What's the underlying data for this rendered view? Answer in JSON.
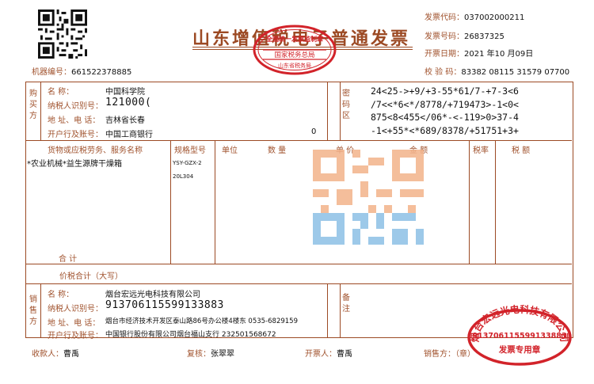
{
  "invoice": {
    "title": "山东增值税电子普通发票",
    "machine_no_label": "机器编号：",
    "machine_no": "661522378885",
    "stamp_top_text": "全国统一发票监制章",
    "stamp_middle_text": "国家税务总局",
    "stamp_bottom_text": "山东省税务局",
    "codes": {
      "code_label": "发票代码：",
      "code": "037002000211",
      "number_label": "发票号码：",
      "number": "26837325",
      "date_label": "开票日期：",
      "date": "2021 年10 月09日",
      "check_label": "校  验  码：",
      "check": "83382 08115 31579 07700"
    }
  },
  "buyer": {
    "section_label": "购买方",
    "name_label": "名          称：",
    "name": "中国科学院",
    "tax_label": "纳税人识别号：",
    "tax_id": "121000(",
    "addr_label": "地  址、电  话：",
    "addr": "吉林省长春",
    "bank_label": "开户行及账号：",
    "bank": "中国工商银行",
    "bank_tail": "0"
  },
  "cipher": {
    "label": "密码区",
    "lines": [
      "24<25->+9/+3-55*61/7-+7-3<6",
      "/7<<*6<*/8778/+719473>-1<0<",
      "875<8<455</06*-<-119>0>37-4",
      "-1<+55*<*689/8378/+51751+3+"
    ]
  },
  "items": {
    "headers": {
      "name": "货物或应税劳务、服务名称",
      "spec": "规格型号",
      "unit": "单位",
      "qty": "数  量",
      "price": "单  价",
      "amount": "金     额",
      "rate": "税率",
      "tax": "税     额"
    },
    "rows": [
      {
        "name": "*农业机械*益生源牌干燥箱",
        "spec_line1": "YSY-GZX-2",
        "spec_line2": "20L304"
      }
    ],
    "subtotal_label": "合          计"
  },
  "total": {
    "label": "价税合计（大写）"
  },
  "seller": {
    "section_label": "销售方",
    "name_label": "名          称：",
    "name": "烟台宏远光电科技有限公司",
    "tax_label": "纳税人识别号：",
    "tax_id": "913706115599133883",
    "addr_label": "地  址、电  话：",
    "addr": "烟台市经济技术开发区泰山路86号办公楼4楼东 0535-6829159",
    "bank_label": "开户行及账号：",
    "bank": "中国银行股份有限公司烟台福山支行 232501568672"
  },
  "remarks": {
    "label": "备注"
  },
  "seal": {
    "company": "烟台宏远光电科技有限公司",
    "tax_id": "913706115599133883",
    "type": "发票专用章"
  },
  "footer": {
    "payee_label": "收款人：",
    "payee": "曹禹",
    "reviewer_label": "复核：",
    "reviewer": "张翠翠",
    "drawer_label": "开票人：",
    "drawer": "曹禹",
    "seller_label": "销售方：（章）"
  },
  "colors": {
    "frame": "#9c4a24",
    "stamp": "#d2232a",
    "watermark_orange": "#f3b38a",
    "watermark_blue": "#8cc0e6"
  }
}
